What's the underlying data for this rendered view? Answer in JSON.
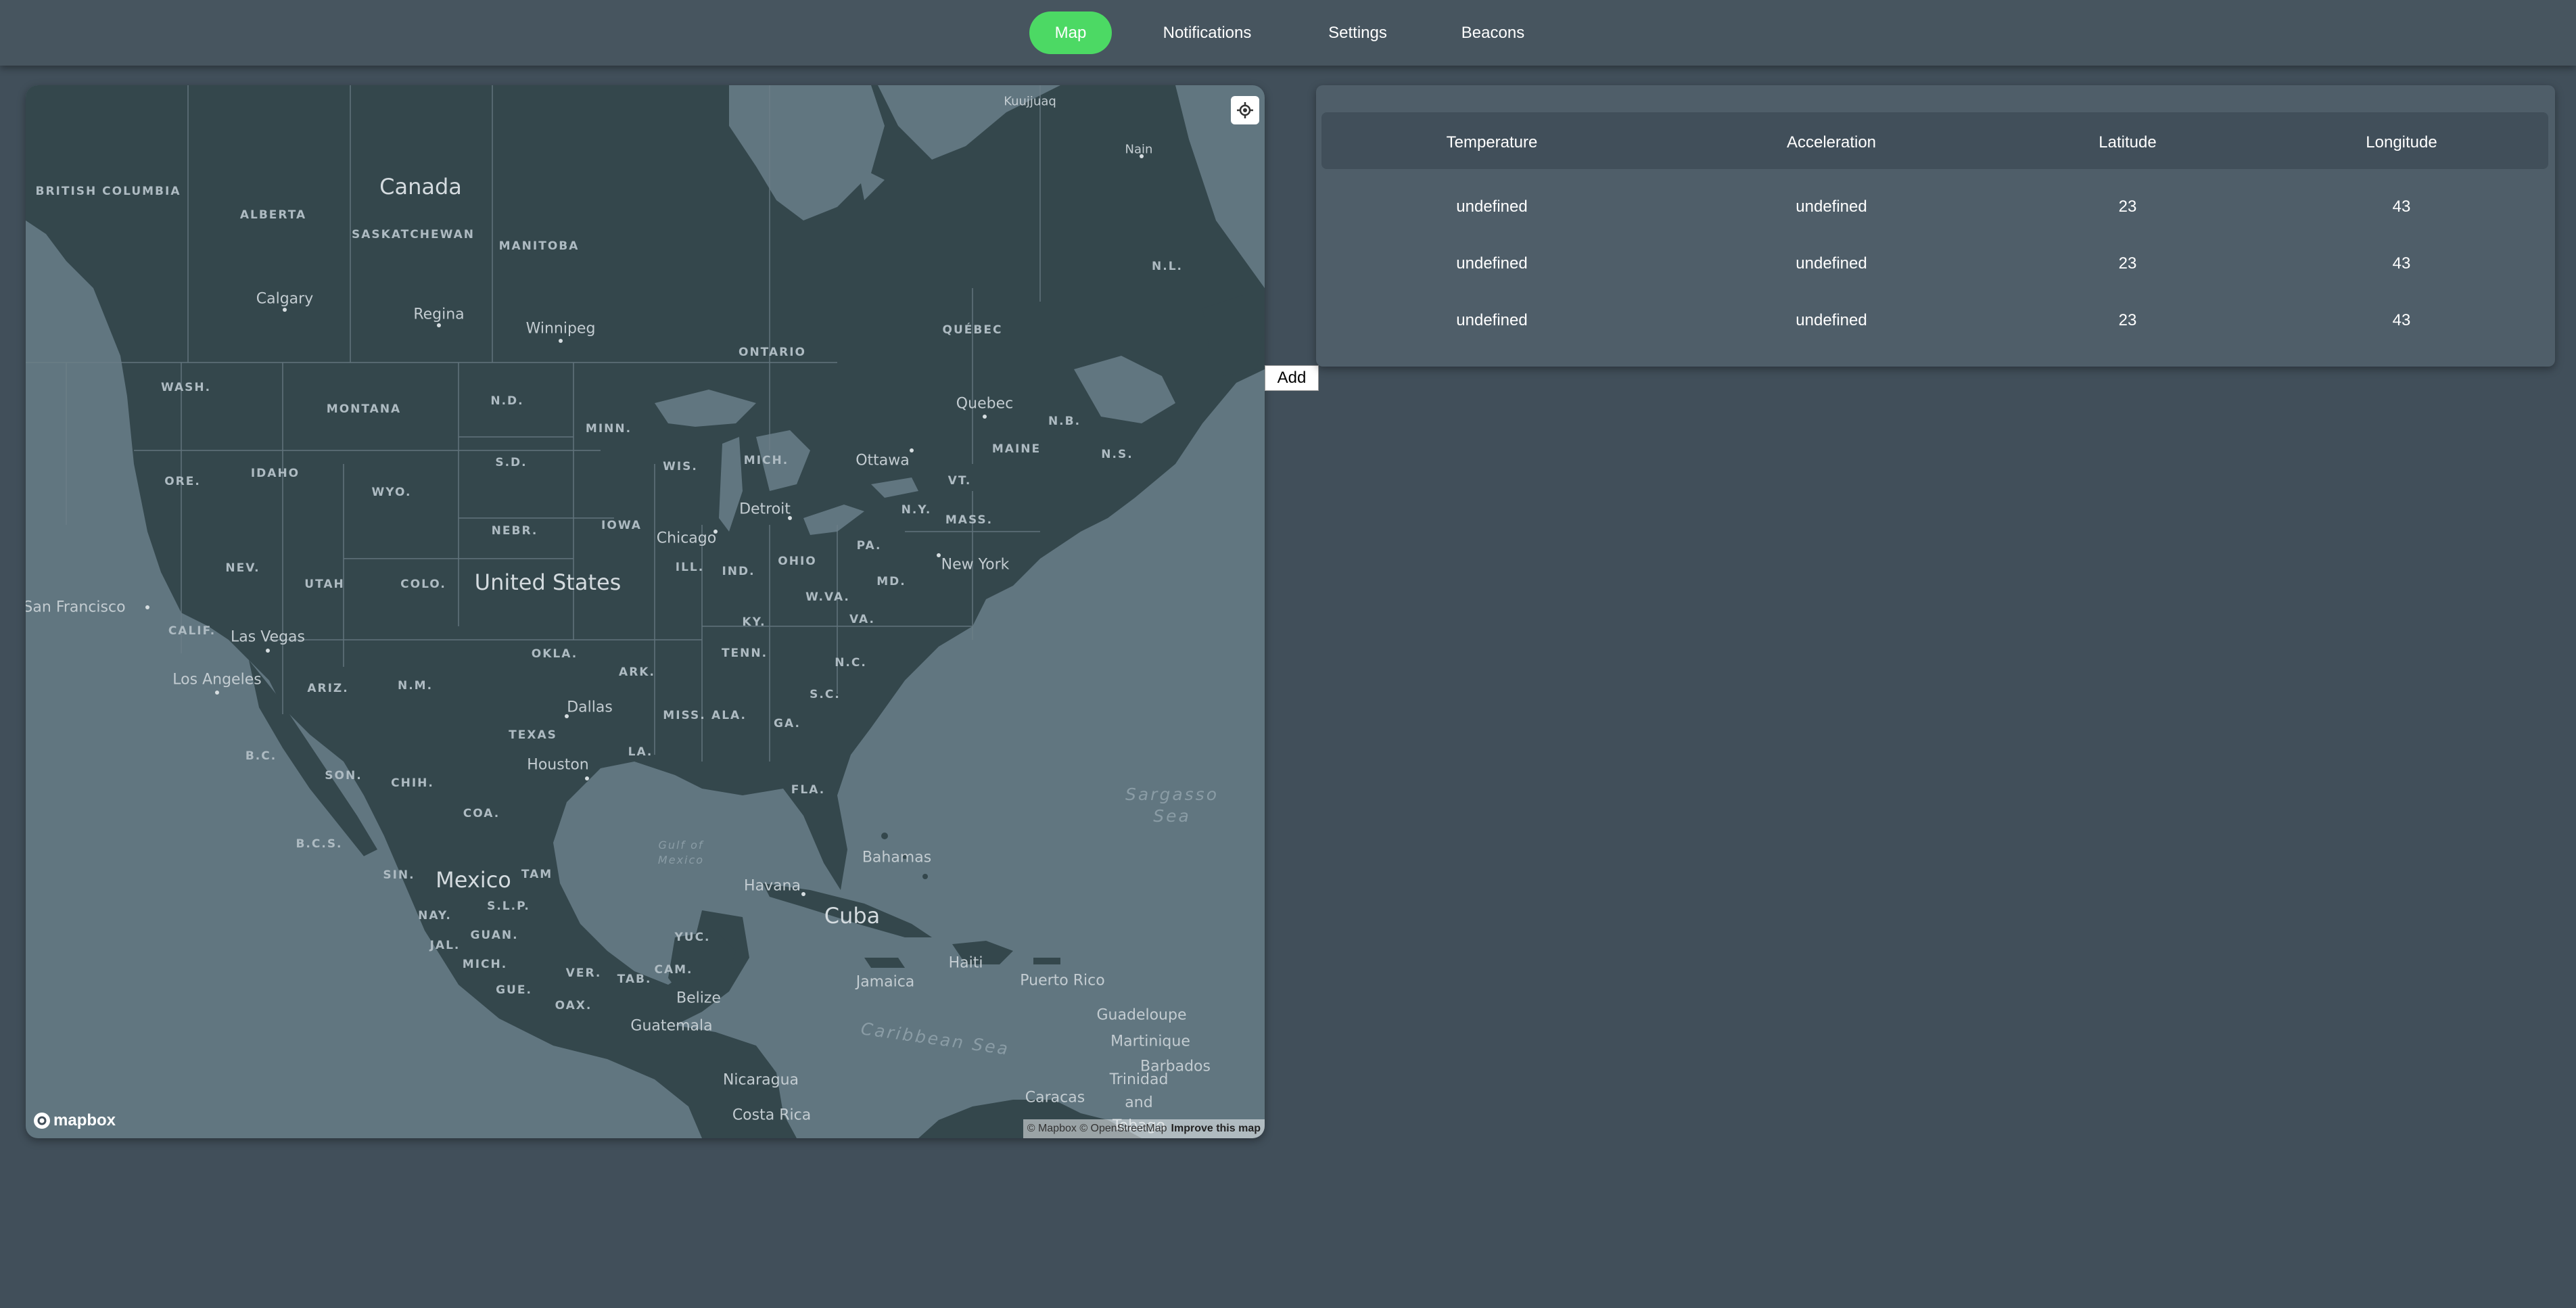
{
  "nav": {
    "items": [
      {
        "label": "Map",
        "active": true
      },
      {
        "label": "Notifications",
        "active": false
      },
      {
        "label": "Settings",
        "active": false
      },
      {
        "label": "Beacons",
        "active": false
      }
    ]
  },
  "map": {
    "countries": [
      "Canada",
      "United States",
      "Mexico",
      "Cuba"
    ],
    "regions": [
      "BRITISH COLUMBIA",
      "ALBERTA",
      "SASKATCHEWAN",
      "MANITOBA",
      "ONTARIO",
      "QUÉBEC",
      "N.L.",
      "N.B.",
      "N.S.",
      "WASH.",
      "ORE.",
      "CALIF.",
      "NEV.",
      "IDAHO",
      "MONTANA",
      "WYO.",
      "UTAH",
      "COLO.",
      "ARIZ.",
      "N.M.",
      "N.D.",
      "S.D.",
      "NEBR.",
      "OKLA.",
      "TEXAS",
      "MINN.",
      "IOWA",
      "WIS.",
      "MICH.",
      "ILL.",
      "IND.",
      "OHIO",
      "KY.",
      "TENN.",
      "ARK.",
      "MISS.",
      "ALA.",
      "GA.",
      "LA.",
      "FLA.",
      "S.C.",
      "N.C.",
      "VA.",
      "W.VA.",
      "PA.",
      "N.Y.",
      "MD.",
      "VT.",
      "MASS.",
      "MAINE",
      "B.C.",
      "SON.",
      "CHIH.",
      "COA.",
      "B.C.S.",
      "SIN.",
      "TAM",
      "NAY.",
      "S.L.P.",
      "JAL.",
      "GUAN.",
      "MICH.",
      "GUE.",
      "OAX.",
      "VER.",
      "TAB.",
      "CAM.",
      "YUC."
    ],
    "cities": [
      "Calgary",
      "Regina",
      "Winnipeg",
      "Quebec",
      "Ottawa",
      "Detroit",
      "Chicago",
      "New York",
      "San Francisco",
      "Las Vegas",
      "Los Angeles",
      "Dallas",
      "Houston",
      "Havana",
      "Bahamas",
      "Jamaica",
      "Haiti",
      "Puerto Rico",
      "Guadeloupe",
      "Martinique",
      "Barbados",
      "Belize",
      "Guatemala",
      "Nicaragua",
      "Costa Rica",
      "Caracas",
      "Trinidad and Tobago",
      "Kuujjuaq",
      "Nain"
    ],
    "water": [
      "Sargasso Sea",
      "Gulf of Mexico",
      "Caribbean Sea"
    ],
    "attribution": "© Mapbox © OpenStreetMap",
    "improve_link": "Improve this map",
    "logo_text": "mapbox",
    "geolocate_icon": "crosshair-icon"
  },
  "add_button": "Add",
  "table": {
    "columns": [
      "Temperature",
      "Acceleration",
      "Latitude",
      "Longitude"
    ],
    "rows": [
      [
        "undefined",
        "undefined",
        "23",
        "43"
      ],
      [
        "undefined",
        "undefined",
        "23",
        "43"
      ],
      [
        "undefined",
        "undefined",
        "23",
        "43"
      ]
    ]
  },
  "colors": {
    "background": "#414f5a",
    "nav_active": "#4cd964",
    "panel": "#4f5e69",
    "land": "#34474c",
    "water": "#617680"
  }
}
